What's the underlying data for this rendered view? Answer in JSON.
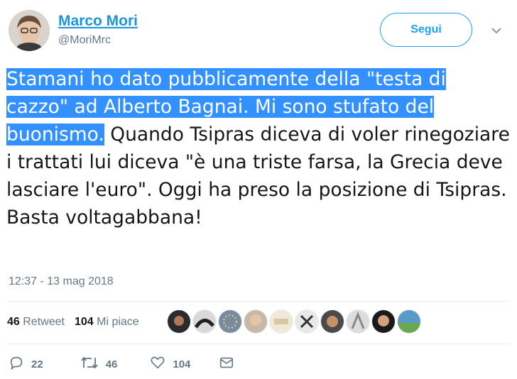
{
  "tweet": {
    "author": {
      "name": "Marco Mori",
      "handle": "@MoriMrc"
    },
    "follow_label": "Segui",
    "text_selected": "Stamani ho dato pubblicamente della \"testa di cazzo\" ad Alberto Bagnai. Mi sono stufato del buonismo.",
    "text_rest": " Quando Tsipras diceva di voler rinegoziare i trattati lui diceva \"è una triste farsa, la Grecia deve lasciare l'euro\". Oggi ha preso la posizione di Tsipras. Basta voltagabbana!",
    "timestamp": "12:37 - 13 mag 2018",
    "stats": {
      "retweets": "46",
      "retweets_label": "Retweet",
      "likes": "104",
      "likes_label": "Mi piace"
    },
    "actions": {
      "replies": "22",
      "retweets": "46",
      "likes": "104"
    },
    "colors": {
      "link": "#1b95e0",
      "accent": "#1da1f2",
      "muted": "#657786",
      "selection": "#3390ff"
    }
  }
}
